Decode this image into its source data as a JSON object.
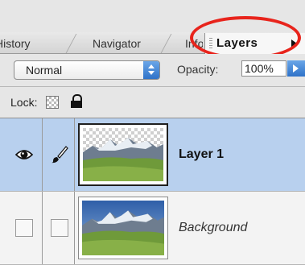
{
  "tabs": [
    {
      "label": "History"
    },
    {
      "label": "Navigator"
    },
    {
      "label": "Info"
    },
    {
      "label": "Layers",
      "active": true
    }
  ],
  "blend": {
    "mode": "Normal",
    "opacity_label": "Opacity:",
    "opacity_value": "100%"
  },
  "lock": {
    "label": "Lock:",
    "icons": [
      "lock-transparent-pixels-icon",
      "lock-all-icon"
    ]
  },
  "layers": [
    {
      "name": "Layer 1",
      "selected": true,
      "visible": true,
      "editable": true,
      "thumbnail": "mountain-landscape-with-transparent-sky"
    },
    {
      "name": "Background",
      "selected": false,
      "visible": false,
      "editable": false,
      "thumbnail": "mountain-landscape"
    }
  ],
  "colors": {
    "accent_highlight": "#e8241c",
    "selection": "#b8d0ee",
    "aqua_blue": "#2f72c8"
  }
}
